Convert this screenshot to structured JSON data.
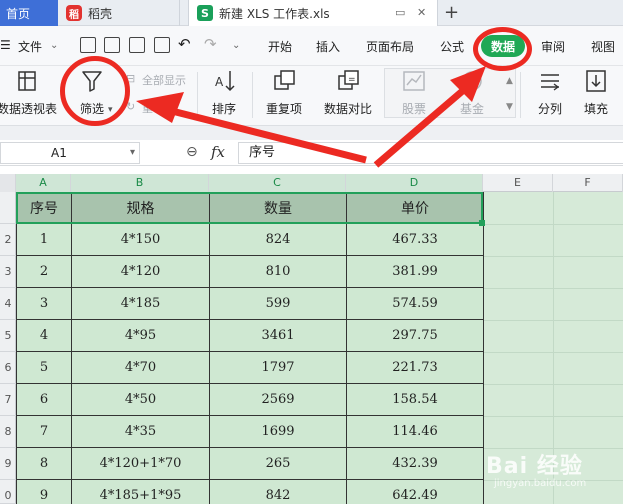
{
  "titlebar": {
    "home_tab": "首页",
    "daoke_tab": "稻壳",
    "file_tab": "新建 XLS 工作表.xls",
    "add_tab": "+"
  },
  "menubar": {
    "file_menu": "文件",
    "tabs": [
      "开始",
      "插入",
      "页面布局",
      "公式",
      "数据",
      "审阅",
      "视图"
    ],
    "active_tab": "数据"
  },
  "ribbon": {
    "pivot": "数据透视表",
    "filter": "筛选",
    "show_all": "全部显示",
    "reapply": "重",
    "sort": "排序",
    "duplicates": "重复项",
    "compare": "数据对比",
    "stock": "股票",
    "fund": "基金",
    "split": "分列",
    "fill": "填充"
  },
  "formula_bar": {
    "cell_ref": "A1",
    "fx": "fx",
    "value": "序号"
  },
  "columns": [
    "A",
    "B",
    "C",
    "D",
    "E",
    "F"
  ],
  "row_numbers": [
    "2",
    "3",
    "4",
    "5",
    "6",
    "7",
    "8",
    "9",
    "0"
  ],
  "table": {
    "headers": [
      "序号",
      "规格",
      "数量",
      "单价"
    ],
    "rows": [
      [
        "1",
        "4*150",
        "824",
        "467.33"
      ],
      [
        "2",
        "4*120",
        "810",
        "381.99"
      ],
      [
        "3",
        "4*185",
        "599",
        "574.59"
      ],
      [
        "4",
        "4*95",
        "3461",
        "297.75"
      ],
      [
        "5",
        "4*70",
        "1797",
        "221.73"
      ],
      [
        "6",
        "4*50",
        "2569",
        "158.54"
      ],
      [
        "7",
        "4*35",
        "1699",
        "114.46"
      ],
      [
        "8",
        "4*120+1*70",
        "265",
        "432.39"
      ],
      [
        "9",
        "4*185+1*95",
        "842",
        "642.49"
      ]
    ]
  },
  "watermark": {
    "main": "Bai 经验",
    "sub": "jingyan.baidu.com"
  },
  "colors": {
    "accent_green": "#1fa855",
    "annotation_red": "#ec2a22",
    "cell_fill": "#cfe8d2",
    "header_fill": "#a8c3ad"
  }
}
